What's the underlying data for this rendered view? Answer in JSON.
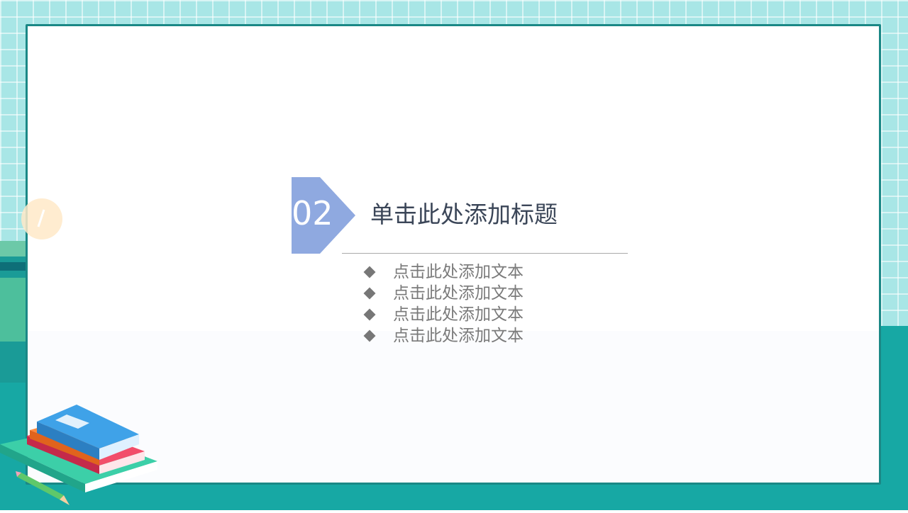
{
  "section": {
    "number": "02",
    "title": "单击此处添加标题",
    "items": [
      "点击此处添加文本",
      "点击此处添加文本",
      "点击此处添加文本",
      "点击此处添加文本"
    ]
  },
  "colors": {
    "grid_background": "#a8e6e6",
    "teal": "#17a8a4",
    "frame_border": "#1a8886",
    "number_badge": "#8fa9e0",
    "title_text": "#3b4658",
    "item_text": "#7a7a7a"
  },
  "icons": [
    "diamond-bullet-icon",
    "books-stack-icon",
    "pencil-icon"
  ]
}
